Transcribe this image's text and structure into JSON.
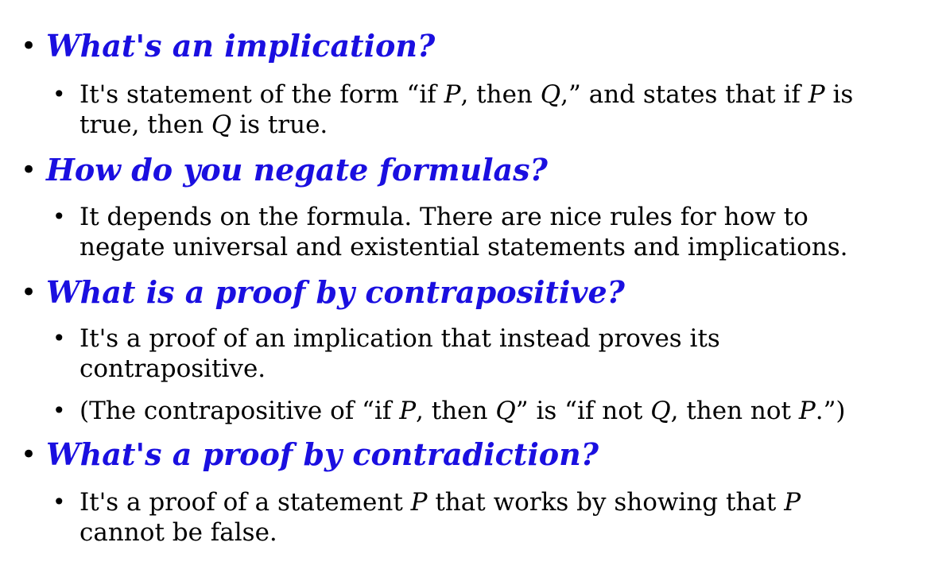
{
  "bullet_glyph": "•",
  "colors": {
    "question": "#1a0fe0",
    "answer": "#000000"
  },
  "items": [
    {
      "question": "What's an implication?",
      "answers": [
        {
          "lines": [
            [
              "It's statement of the form “if ",
              {
                "i": "P"
              },
              ", then ",
              {
                "i": "Q"
              },
              ",” and states that if ",
              {
                "i": "P"
              },
              " is"
            ],
            [
              "true, then ",
              {
                "i": "Q"
              },
              " is true."
            ]
          ]
        }
      ]
    },
    {
      "question": "How do you negate formulas?",
      "answers": [
        {
          "lines": [
            [
              "It depends on the formula. There are nice rules for how to"
            ],
            [
              "negate universal and existential statements and implications."
            ]
          ]
        }
      ]
    },
    {
      "question": "What is a proof by contrapositive?",
      "answers": [
        {
          "lines": [
            [
              "It's a proof of an implication that instead proves its"
            ],
            [
              "contrapositive."
            ]
          ]
        },
        {
          "lines": [
            [
              "(The contrapositive of “if ",
              {
                "i": "P"
              },
              ", then ",
              {
                "i": "Q"
              },
              "” is “if not ",
              {
                "i": "Q"
              },
              ", then not ",
              {
                "i": "P"
              },
              ".”)"
            ]
          ]
        }
      ]
    },
    {
      "question": "What's a proof by contradiction?",
      "answers": [
        {
          "lines": [
            [
              "It's a proof of a statement ",
              {
                "i": "P"
              },
              " that works by showing that ",
              {
                "i": "P"
              }
            ],
            [
              "cannot be false."
            ]
          ]
        }
      ]
    }
  ]
}
